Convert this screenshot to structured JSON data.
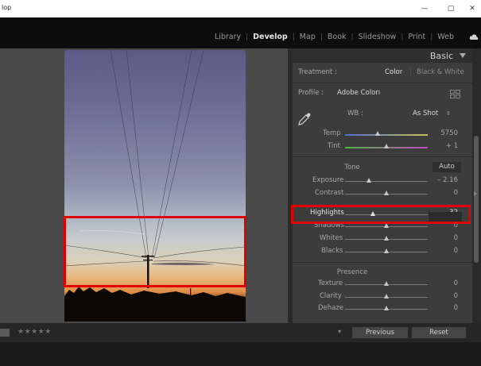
{
  "window": {
    "title": "lop",
    "min": "—",
    "max": "▢",
    "close": "✕"
  },
  "modules": [
    "Library",
    "Develop",
    "Map",
    "Book",
    "Slideshow",
    "Print",
    "Web"
  ],
  "active_module": "Develop",
  "panel": {
    "title": "Basic",
    "treatment": {
      "label": "Treatment :",
      "color": "Color",
      "bw": "Black & White"
    },
    "profile": {
      "label": "Profile :",
      "value": "Adobe Color"
    },
    "wb": {
      "label": "WB :",
      "value": "As Shot"
    },
    "temp": {
      "label": "Temp",
      "value": "5750"
    },
    "tint": {
      "label": "Tint",
      "value": "+ 1"
    },
    "tone": {
      "title": "Tone",
      "auto": "Auto"
    },
    "exposure": {
      "label": "Exposure",
      "value": "– 2.16"
    },
    "contrast": {
      "label": "Contrast",
      "value": "0"
    },
    "highlights": {
      "label": "Highlights",
      "value": "– 32"
    },
    "shadows": {
      "label": "Shadows",
      "value": "0"
    },
    "whites": {
      "label": "Whites",
      "value": "0"
    },
    "blacks": {
      "label": "Blacks",
      "value": "0"
    },
    "presence": {
      "title": "Presence"
    },
    "texture": {
      "label": "Texture",
      "value": "0"
    },
    "clarity": {
      "label": "Clarity",
      "value": "0"
    },
    "dehaze": {
      "label": "Dehaze",
      "value": "0"
    }
  },
  "sliders": {
    "temp": 0.4,
    "tint": 0.5,
    "exposure": 0.29,
    "contrast": 0.5,
    "highlights": 0.34,
    "shadows": 0.5,
    "whites": 0.5,
    "blacks": 0.5,
    "texture": 0.5,
    "clarity": 0.5,
    "dehaze": 0.5
  },
  "bottombar": {
    "stars": "★★★★★",
    "previous": "Previous",
    "reset": "Reset"
  },
  "colors": {
    "highlight_box": "#e00000",
    "active_module": "#e6e6e6"
  }
}
